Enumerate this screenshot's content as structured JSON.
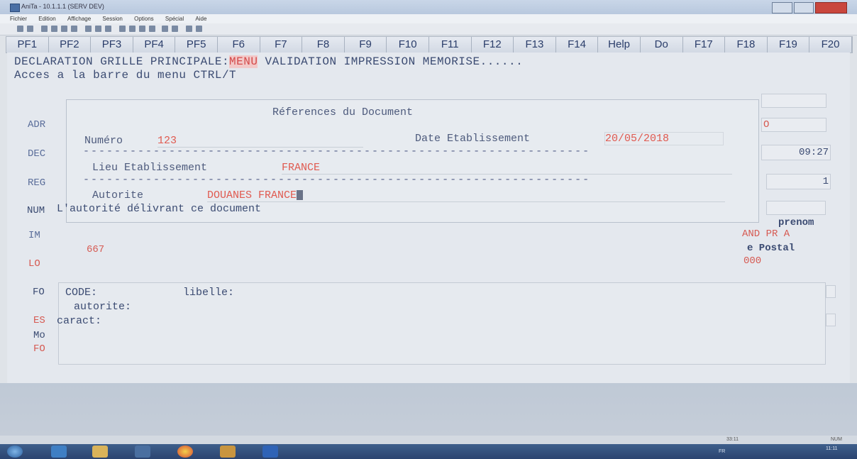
{
  "window": {
    "title": "AniTa - 10.1.1.1 (SERV DEV)"
  },
  "menu": [
    "Fichier",
    "Edition",
    "Affichage",
    "Session",
    "Options",
    "Spécial",
    "Aide"
  ],
  "fkeys": [
    "PF1",
    "PF2",
    "PF3",
    "PF4",
    "PF5",
    "F6",
    "F7",
    "F8",
    "F9",
    "F10",
    "F11",
    "F12",
    "F13",
    "F14",
    "Help",
    "Do",
    "F17",
    "F18",
    "F19",
    "F20"
  ],
  "terminal": {
    "header_prefix": "DECLARATION GRILLE PRINCIPALE:",
    "menu_highlight": "MENU",
    "header_suffix": " VALIDATION IMPRESSION MEMORISE......",
    "hint": "Acces a la barre du menu CTRL/T"
  },
  "document": {
    "title": "Réferences du Document",
    "numero_label": "Numéro",
    "numero_value": "123",
    "date_label": "Date Etablissement",
    "date_value": "20/05/2018",
    "lieu_label": "Lieu Etablissement",
    "lieu_value": "FRANCE",
    "autorite_label": "Autorite",
    "autorite_value": "DOUANES FRANCE",
    "description": "L'autorité délivrant ce document"
  },
  "side_labels": {
    "adr": "ADR",
    "dec": "DEC",
    "reg": "REG",
    "num": "NUM",
    "im": "IM",
    "lo": "LO",
    "fo": "FO",
    "es": "ES",
    "mo": "Mo",
    "fo2": "FO"
  },
  "right_fields": {
    "zero": "O",
    "time": "09:27",
    "one": "1",
    "prenom": "prenom",
    "and_pr": "AND PR A",
    "postal": "e Postal",
    "postal_code": "000"
  },
  "mid": {
    "value_667": "667"
  },
  "bottom": {
    "code_label": "CODE:",
    "libelle_label": "libelle:",
    "autorite_label": "autorite:",
    "caract_label": "caract:"
  },
  "status": {
    "pos": "33:11",
    "num": "NUM"
  },
  "tray": {
    "lang": "FR",
    "time": "11:11"
  },
  "colors": {
    "accent_red": "#e05a50",
    "text_blue": "#3b4b72"
  }
}
